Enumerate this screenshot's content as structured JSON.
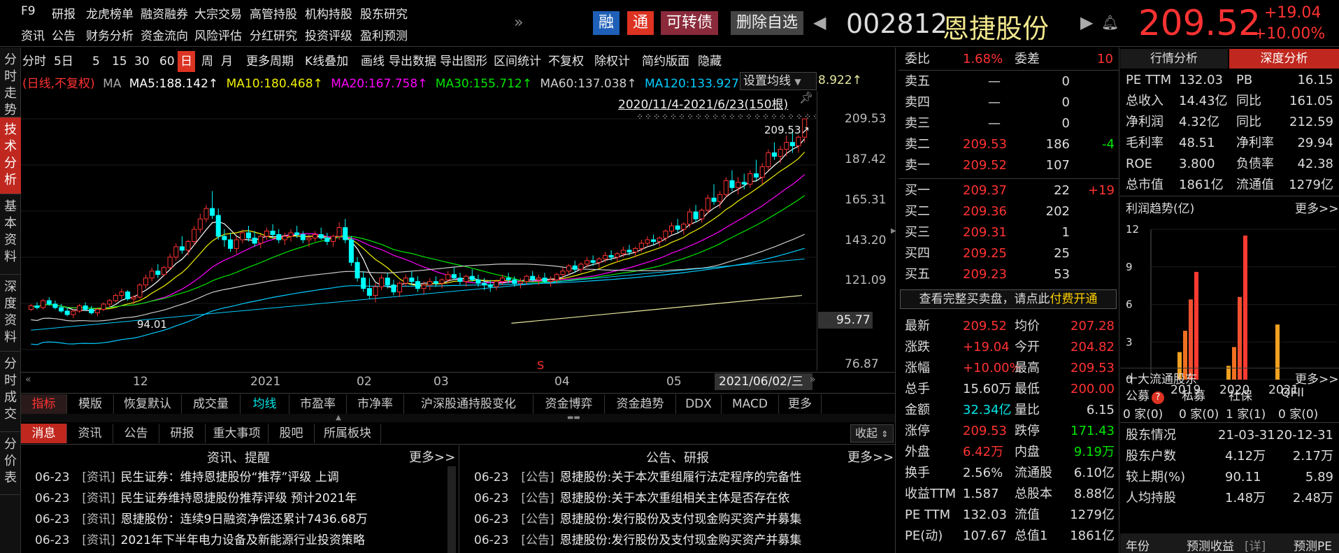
{
  "top_menu": {
    "row1": [
      "F9",
      "研报",
      "龙虎榜单",
      "融资融券",
      "大宗交易",
      "高管持股",
      "机构持股",
      "股东研究"
    ],
    "row2": [
      "资讯",
      "公告",
      "财务分析",
      "资金流向",
      "风险评估",
      "分红研究",
      "投资评级",
      "盈利预测"
    ],
    "more": "»"
  },
  "header": {
    "badge_rong": "融",
    "badge_tong": "通",
    "badge_kzz": "可转债",
    "delete_btn": "删除自选",
    "code": "002812",
    "name": "恩捷股份",
    "price": "209.52",
    "change": "+19.04",
    "change_pct": "+10.00%"
  },
  "side_tabs": [
    "分时走势",
    "技术分析",
    "基本资料",
    "深度资料",
    "分时成交",
    "分价表"
  ],
  "toolbar": [
    "分时",
    "5日",
    "5",
    "15",
    "30",
    "60",
    "日",
    "周",
    "月",
    "更多周期",
    "K线叠加",
    "画线",
    "导出数据",
    "导出图形",
    "区间统计",
    "不复权",
    "除权计",
    "简约版面",
    "隐藏"
  ],
  "ma_legend": {
    "mode": "(日线,不复权)",
    "ma": "MA",
    "ma5": "MA5:188.142↑",
    "ma10": "MA10:180.468↑",
    "ma20": "MA20:167.758↑",
    "ma30": "MA30:155.712↑",
    "ma60": "MA60:137.038↑",
    "ma120": "MA120:133.927",
    "ma250": "8.922↑",
    "set_ma": "设置均线"
  },
  "chart_data": {
    "type": "candlestick",
    "range_label": "2020/11/4-2021/6/23(150根)",
    "high_label": "209.53↗",
    "low_label": "94.01",
    "current_price_box": "95.77",
    "y_ticks": [
      "209.53",
      "187.42",
      "165.31",
      "143.20",
      "121.09",
      "76.87"
    ],
    "ylim": [
      76.87,
      209.53
    ],
    "x_ticks": [
      "12",
      "2021",
      "02",
      "03",
      "04",
      "05"
    ],
    "cursor_date": "2021/06/02/三",
    "candles": [
      [
        100,
        103,
        99,
        102
      ],
      [
        102,
        104,
        100,
        101
      ],
      [
        101,
        106,
        100,
        105
      ],
      [
        105,
        107,
        102,
        103
      ],
      [
        103,
        105,
        100,
        101
      ],
      [
        101,
        103,
        98,
        99
      ],
      [
        99,
        101,
        96,
        97
      ],
      [
        97,
        100,
        95,
        99
      ],
      [
        99,
        103,
        98,
        102
      ],
      [
        102,
        104,
        99,
        100
      ],
      [
        100,
        102,
        97,
        98
      ],
      [
        98,
        101,
        96,
        100
      ],
      [
        100,
        104,
        99,
        103
      ],
      [
        103,
        106,
        101,
        105
      ],
      [
        105,
        109,
        104,
        108
      ],
      [
        108,
        112,
        106,
        110
      ],
      [
        110,
        111,
        105,
        106
      ],
      [
        106,
        108,
        103,
        107
      ],
      [
        107,
        115,
        106,
        114
      ],
      [
        114,
        120,
        112,
        118
      ],
      [
        118,
        124,
        116,
        122
      ],
      [
        122,
        126,
        118,
        120
      ],
      [
        120,
        125,
        119,
        124
      ],
      [
        124,
        132,
        123,
        130
      ],
      [
        130,
        138,
        128,
        136
      ],
      [
        136,
        142,
        132,
        134
      ],
      [
        134,
        140,
        131,
        139
      ],
      [
        139,
        148,
        137,
        146
      ],
      [
        146,
        155,
        144,
        152
      ],
      [
        152,
        160,
        150,
        158
      ],
      [
        158,
        168,
        152,
        154
      ],
      [
        154,
        158,
        140,
        142
      ],
      [
        142,
        146,
        136,
        140
      ],
      [
        140,
        144,
        133,
        135
      ],
      [
        135,
        142,
        132,
        140
      ],
      [
        140,
        146,
        138,
        144
      ],
      [
        144,
        148,
        139,
        141
      ],
      [
        141,
        145,
        136,
        138
      ],
      [
        138,
        143,
        135,
        142
      ],
      [
        142,
        147,
        140,
        145
      ],
      [
        145,
        149,
        141,
        143
      ],
      [
        143,
        146,
        138,
        140
      ],
      [
        140,
        144,
        137,
        142
      ],
      [
        142,
        146,
        139,
        144
      ],
      [
        144,
        148,
        141,
        143
      ],
      [
        143,
        145,
        138,
        140
      ],
      [
        140,
        143,
        136,
        141
      ],
      [
        141,
        145,
        139,
        143
      ],
      [
        143,
        147,
        140,
        141
      ],
      [
        141,
        144,
        137,
        139
      ],
      [
        139,
        143,
        136,
        142
      ],
      [
        142,
        150,
        140,
        147
      ],
      [
        147,
        152,
        138,
        140
      ],
      [
        140,
        142,
        125,
        127
      ],
      [
        127,
        130,
        116,
        118
      ],
      [
        118,
        122,
        110,
        112
      ],
      [
        112,
        118,
        106,
        108
      ],
      [
        108,
        115,
        104,
        113
      ],
      [
        113,
        120,
        111,
        118
      ],
      [
        118,
        121,
        112,
        114
      ],
      [
        114,
        117,
        108,
        110
      ],
      [
        110,
        116,
        107,
        115
      ],
      [
        115,
        120,
        113,
        118
      ],
      [
        118,
        122,
        114,
        116
      ],
      [
        116,
        119,
        110,
        112
      ],
      [
        112,
        116,
        109,
        114
      ],
      [
        114,
        118,
        111,
        116
      ],
      [
        116,
        119,
        113,
        115
      ],
      [
        115,
        118,
        112,
        117
      ],
      [
        117,
        122,
        115,
        120
      ],
      [
        120,
        124,
        117,
        118
      ],
      [
        118,
        121,
        114,
        116
      ],
      [
        116,
        120,
        113,
        119
      ],
      [
        119,
        123,
        116,
        117
      ],
      [
        117,
        120,
        113,
        115
      ],
      [
        115,
        118,
        111,
        114
      ],
      [
        114,
        117,
        110,
        113
      ],
      [
        113,
        117,
        111,
        116
      ],
      [
        116,
        120,
        114,
        118
      ],
      [
        118,
        121,
        115,
        117
      ],
      [
        117,
        119,
        113,
        115
      ],
      [
        115,
        118,
        112,
        116
      ],
      [
        116,
        120,
        114,
        119
      ],
      [
        119,
        122,
        116,
        117
      ],
      [
        117,
        120,
        114,
        118
      ],
      [
        118,
        121,
        115,
        116
      ],
      [
        116,
        119,
        113,
        117
      ],
      [
        117,
        121,
        115,
        120
      ],
      [
        120,
        124,
        118,
        122
      ],
      [
        122,
        126,
        120,
        125
      ],
      [
        125,
        128,
        121,
        123
      ],
      [
        123,
        127,
        121,
        126
      ],
      [
        126,
        130,
        124,
        128
      ],
      [
        128,
        131,
        125,
        127
      ],
      [
        127,
        130,
        124,
        129
      ],
      [
        129,
        133,
        127,
        131
      ],
      [
        131,
        134,
        128,
        130
      ],
      [
        130,
        133,
        127,
        132
      ],
      [
        132,
        136,
        130,
        134
      ],
      [
        134,
        137,
        131,
        133
      ],
      [
        133,
        136,
        130,
        135
      ],
      [
        135,
        140,
        133,
        138
      ],
      [
        138,
        142,
        136,
        140
      ],
      [
        140,
        143,
        137,
        139
      ],
      [
        139,
        142,
        136,
        141
      ],
      [
        141,
        146,
        139,
        145
      ],
      [
        145,
        150,
        143,
        148
      ],
      [
        148,
        152,
        144,
        146
      ],
      [
        146,
        150,
        143,
        149
      ],
      [
        149,
        158,
        147,
        156
      ],
      [
        156,
        160,
        150,
        152
      ],
      [
        152,
        158,
        150,
        157
      ],
      [
        157,
        166,
        155,
        164
      ],
      [
        164,
        172,
        160,
        162
      ],
      [
        162,
        168,
        158,
        166
      ],
      [
        166,
        176,
        164,
        174
      ],
      [
        174,
        180,
        168,
        170
      ],
      [
        170,
        176,
        166,
        173
      ],
      [
        173,
        178,
        169,
        172
      ],
      [
        172,
        180,
        170,
        178
      ],
      [
        178,
        186,
        174,
        176
      ],
      [
        176,
        184,
        172,
        182
      ],
      [
        182,
        192,
        180,
        190
      ],
      [
        190,
        196,
        186,
        188
      ],
      [
        188,
        194,
        184,
        192
      ],
      [
        192,
        200,
        188,
        196
      ],
      [
        196,
        203,
        190,
        194
      ],
      [
        194,
        200,
        190,
        199
      ],
      [
        199,
        209.53,
        196,
        209.52
      ]
    ]
  },
  "bottom_tabs": [
    "指标",
    "模版",
    "恢复默认",
    "成交量",
    "均线",
    "市盈率",
    "市净率",
    "沪深股通持股变化",
    "资金博弈",
    "资金趋势",
    "DDX",
    "MACD",
    "更多"
  ],
  "news_tabs": [
    "消息",
    "资讯",
    "公告",
    "研报",
    "重大事项",
    "股吧",
    "所属板块"
  ],
  "collapse": "收起",
  "news_left": {
    "title": "资讯、提醒",
    "more": "更多>>",
    "items": [
      {
        "date": "06-23",
        "tag": "[资讯]",
        "text": "民生证券：维持恩捷股份“推荐”评级 上调"
      },
      {
        "date": "06-23",
        "tag": "[资讯]",
        "text": "民生证券维持恩捷股份推荐评级 预计2021年"
      },
      {
        "date": "06-23",
        "tag": "[资讯]",
        "text": "恩捷股份：连续9日融资净偿还累计7436.68万"
      },
      {
        "date": "06-23",
        "tag": "[资讯]",
        "text": "2021年下半年电力设备及新能源行业投资策略"
      }
    ]
  },
  "news_right": {
    "title": "公告、研报",
    "more": "更多>>",
    "items": [
      {
        "date": "06-23",
        "tag": "[公告]",
        "text": "恩捷股份:关于本次重组履行法定程序的完备性"
      },
      {
        "date": "06-23",
        "tag": "[公告]",
        "text": "恩捷股份:关于本次重组相关主体是否存在依"
      },
      {
        "date": "06-23",
        "tag": "[公告]",
        "text": "恩捷股份:发行股份及支付现金购买资产并募集"
      },
      {
        "date": "06-23",
        "tag": "[公告]",
        "text": "恩捷股份:发行股份及支付现金购买资产并募集"
      }
    ]
  },
  "order_book": {
    "weibi_label": "委比",
    "weibi": "1.68%",
    "weicha_label": "委差",
    "weicha": "10",
    "sell": [
      {
        "label": "卖五",
        "price": "—",
        "vol": "0",
        "chg": ""
      },
      {
        "label": "卖四",
        "price": "—",
        "vol": "0",
        "chg": ""
      },
      {
        "label": "卖三",
        "price": "—",
        "vol": "0",
        "chg": ""
      },
      {
        "label": "卖二",
        "price": "209.53",
        "vol": "186",
        "chg": "-4"
      },
      {
        "label": "卖一",
        "price": "209.52",
        "vol": "107",
        "chg": ""
      }
    ],
    "buy": [
      {
        "label": "买一",
        "price": "209.37",
        "vol": "22",
        "chg": "+19"
      },
      {
        "label": "买二",
        "price": "209.36",
        "vol": "202",
        "chg": ""
      },
      {
        "label": "买三",
        "price": "209.31",
        "vol": "1",
        "chg": ""
      },
      {
        "label": "买四",
        "price": "209.25",
        "vol": "25",
        "chg": ""
      },
      {
        "label": "买五",
        "price": "209.23",
        "vol": "53",
        "chg": ""
      }
    ],
    "full_book_text": "查看完整买卖盘，请点此",
    "pay": "付费开通"
  },
  "quote": [
    [
      "最新",
      "209.52",
      "均价",
      "207.28"
    ],
    [
      "涨跌",
      "+19.04",
      "今开",
      "204.82"
    ],
    [
      "涨幅",
      "+10.00%",
      "最高",
      "209.53"
    ],
    [
      "总手",
      "15.60万",
      "最低",
      "200.00"
    ],
    [
      "金额",
      "32.34亿",
      "量比",
      "6.15"
    ],
    [
      "涨停",
      "209.53",
      "跌停",
      "171.43"
    ],
    [
      "外盘",
      "6.42万",
      "内盘",
      "9.19万"
    ],
    [
      "换手",
      "2.56%",
      "流通股",
      "6.10亿"
    ],
    [
      "收益TTM",
      "1.587",
      "总股本",
      "8.88亿"
    ],
    [
      "PE TTM",
      "132.03",
      "流值",
      "1279亿"
    ],
    [
      "PE(动)",
      "107.67",
      "总值1",
      "1861亿"
    ]
  ],
  "right_tabs": [
    "行情分析",
    "深度分析"
  ],
  "fundamentals": [
    [
      "PE TTM",
      "132.03",
      "PB",
      "16.15"
    ],
    [
      "总收入",
      "14.43亿",
      "同比",
      "161.05"
    ],
    [
      "净利润",
      "4.32亿",
      "同比",
      "212.59"
    ],
    [
      "毛利率",
      "48.51",
      "净利率",
      "29.94"
    ],
    [
      "ROE",
      "3.800",
      "负债率",
      "42.38"
    ],
    [
      "总市值",
      "1861亿",
      "流通值",
      "1279亿"
    ]
  ],
  "profit_trend": {
    "title": "利润趋势(亿)",
    "more": "更多>>",
    "y_ticks": [
      "12",
      "9",
      "6",
      "3",
      "0"
    ],
    "years": [
      "2019",
      "2020",
      "2021"
    ],
    "bars": [
      [
        2.2,
        3.9,
        6.4,
        8.6
      ],
      [
        1.1,
        2.6,
        6.6,
        11.5
      ],
      [
        4.4
      ]
    ]
  },
  "holders": {
    "title": "十大流通股东",
    "more": "更多>>",
    "cats": [
      "公募",
      "私募",
      "社保",
      "QFII"
    ],
    "vals": [
      "0 家(0)",
      "0 家(0)",
      "1 家(1)",
      "0 家(0)"
    ]
  },
  "shareholders": [
    [
      "股东情况",
      "21-03-31",
      "20-12-31"
    ],
    [
      "股东户数",
      "4.12万",
      "2.17万"
    ],
    [
      "较上期(%)",
      "90.11",
      "5.89"
    ],
    [
      "人均持股",
      "1.48万",
      "2.48万"
    ]
  ],
  "forecast": [
    "年份",
    "预测收益",
    "[详]",
    "预测PE"
  ],
  "colors": {
    "up": "#ff3232",
    "down": "#00ffff",
    "accent": "#c0281f",
    "ma5": "#ffffff",
    "ma10": "#f0f000",
    "ma20": "#ff00ff",
    "ma30": "#00e600",
    "ma60": "#cccccc",
    "ma120": "#00ccff",
    "ma250": "#e8e8a0"
  }
}
